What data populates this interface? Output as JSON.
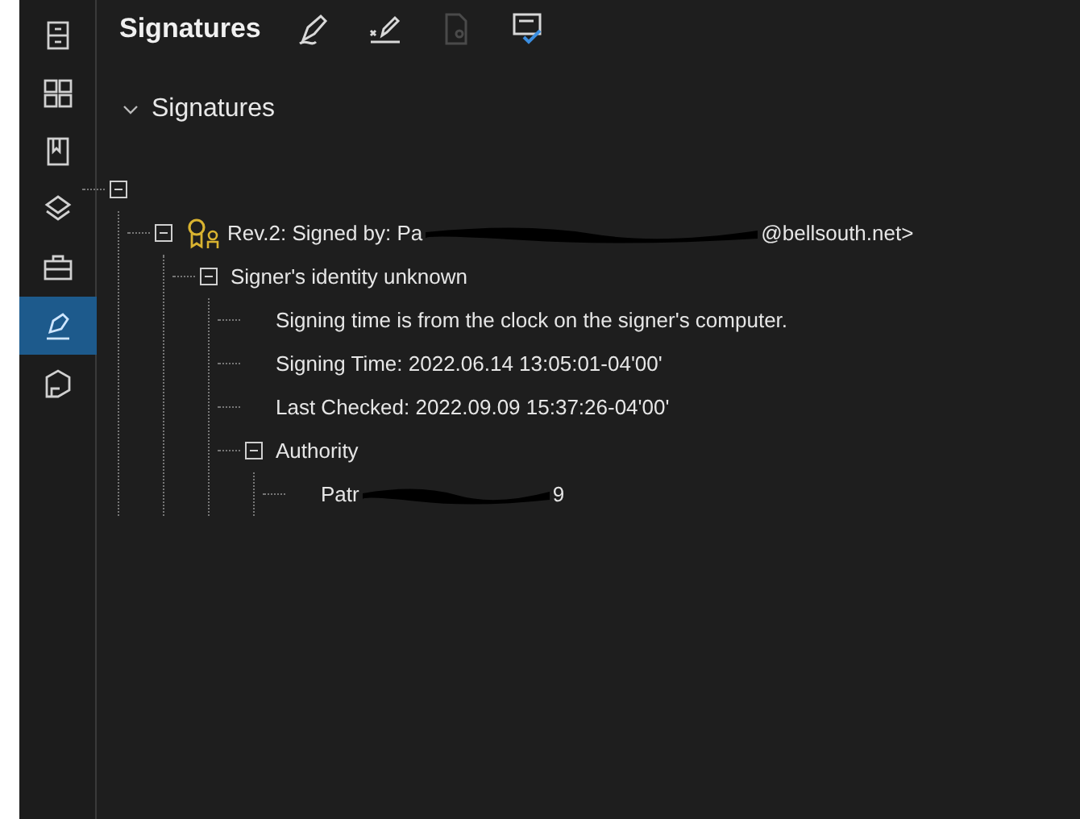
{
  "sidebar": {
    "items": [
      {
        "kind": "cabinet",
        "selected": false
      },
      {
        "kind": "grid",
        "selected": false
      },
      {
        "kind": "bookmark",
        "selected": false
      },
      {
        "kind": "layers",
        "selected": false
      },
      {
        "kind": "briefcase",
        "selected": false
      },
      {
        "kind": "pen",
        "selected": true
      },
      {
        "kind": "shape",
        "selected": false
      }
    ]
  },
  "toolbar": {
    "title": "Signatures",
    "buttons": [
      {
        "kind": "sign",
        "disabled": false
      },
      {
        "kind": "sign-line",
        "disabled": false
      },
      {
        "kind": "document",
        "disabled": true
      },
      {
        "kind": "validate",
        "disabled": false
      }
    ]
  },
  "section": {
    "label": "Signatures",
    "expanded": true
  },
  "tree": [
    {
      "expanded": true,
      "children": [
        {
          "kind": "signature",
          "label": "Rev.2: Signed by: Pa",
          "label_end": "@bellsouth.net>",
          "expanded": true,
          "children": [
            {
              "label": "Signer's identity unknown",
              "expanded": true,
              "children": [
                {
                  "label": "Signing time is from the clock on the signer's computer."
                },
                {
                  "label": "Signing Time: 2022.06.14 13:05:01-04'00'"
                },
                {
                  "label": "Last Checked: 2022.09.09 15:37:26-04'00'"
                },
                {
                  "label": "Authority",
                  "expanded": true,
                  "children": [
                    {
                      "label": "Patr",
                      "label_end": "9"
                    }
                  ]
                }
              ]
            }
          ]
        }
      ]
    }
  ]
}
